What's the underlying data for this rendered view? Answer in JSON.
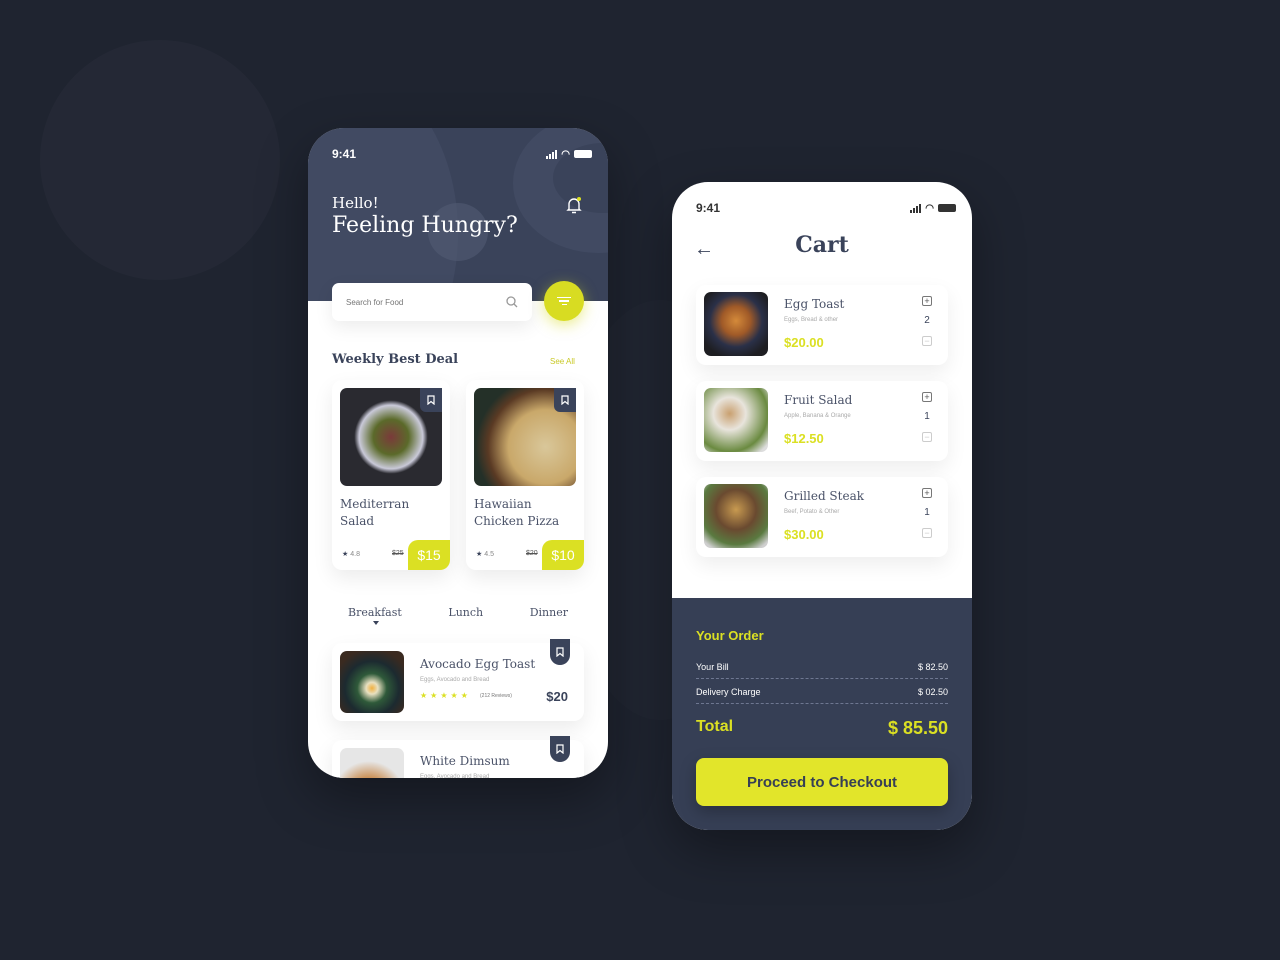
{
  "colors": {
    "accent": "#dbe023",
    "navy": "#3a435a",
    "background": "#1f2430"
  },
  "home": {
    "status": {
      "time": "9:41"
    },
    "greeting": "Hello!",
    "headline": "Feeling Hungry?",
    "search": {
      "placeholder": "Search for Food"
    },
    "section_title": "Weekly Best Deal",
    "see_all": "See All",
    "deals": [
      {
        "name": "Mediterran Salad",
        "rating": "4.8",
        "old_price": "$25",
        "price": "$15"
      },
      {
        "name": "Hawaiian Chicken Pizza",
        "rating": "4.5",
        "old_price": "$20",
        "price": "$10"
      }
    ],
    "tabs": [
      {
        "label": "Breakfast",
        "active": true
      },
      {
        "label": "Lunch"
      },
      {
        "label": "Dinner"
      }
    ],
    "list": [
      {
        "name": "Avocado Egg Toast",
        "desc": "Eggs, Avocado and Bread",
        "stars": 5,
        "reviews": "(212 Reviews)",
        "price": "$20"
      },
      {
        "name": "White Dimsum",
        "desc": "Eggs, Avocado and Bread"
      }
    ]
  },
  "cart": {
    "status": {
      "time": "9:41"
    },
    "title": "Cart",
    "items": [
      {
        "name": "Egg Toast",
        "desc": "Eggs, Bread & other",
        "price": "$20.00",
        "qty": "2"
      },
      {
        "name": "Fruit Salad",
        "desc": "Apple, Banana & Orange",
        "price": "$12.50",
        "qty": "1"
      },
      {
        "name": "Grilled Steak",
        "desc": "Beef, Potato & Other",
        "price": "$30.00",
        "qty": "1"
      }
    ],
    "order": {
      "title": "Your Order",
      "bill_label": "Your Bill",
      "bill": "$ 82.50",
      "delivery_label": "Delivery Charge",
      "delivery": "$ 02.50",
      "total_label": "Total",
      "total": "$ 85.50"
    },
    "checkout_label": "Proceed to Checkout"
  }
}
